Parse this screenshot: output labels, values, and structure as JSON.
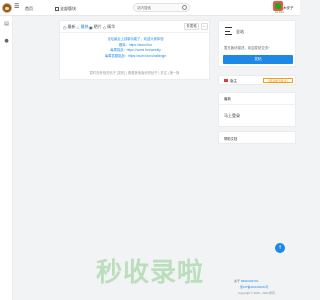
{
  "header": {
    "nav_home": "首页",
    "nav_all": "全部版块",
    "search_placeholder": "站内搜索",
    "user_name": "木安子",
    "user_level": "lv1 0/10"
  },
  "tabs": [
    {
      "label": "最新",
      "icon": "clock-icon"
    },
    {
      "label": "最热",
      "icon": "fire-icon"
    },
    {
      "label": "晒片",
      "icon": "image-icon"
    },
    {
      "label": "精华",
      "icon": "diamond-icon"
    }
  ],
  "toolbar": {
    "apply_label": "去发帖",
    "more_label": "⋯"
  },
  "announcement": {
    "lines": [
      "论坛最近上线新功能了，欢迎大家体验",
      "题库：https://xuexi.fun",
      "每周挑战：https://xuexi.fun/weekly",
      "每周答题挑战：https://xuexi.fun/challenge"
    ]
  },
  "empty_tip": "暂时没有相关帖子 [发布] | 看看其他版块的帖子 | 关注 | 换一换",
  "sidebar_right": {
    "card_title": "全站",
    "card_desc": "暂无版块描述，欢迎发帖交流~",
    "publish_label": "发帖",
    "flag_label": "版主",
    "flag_link": "（申请成为版主）",
    "login_section_title": "最新",
    "login_label": "马上登录",
    "docs_label": "帮助文档"
  },
  "footer": {
    "about_prefix": "关于",
    "about_link": "9999.099.5th",
    "icp": "浙ICP备2021000001号",
    "copyright": "Copyright © 2019 - 2023 所有"
  },
  "watermark": "秒收录啦",
  "colors": {
    "accent": "#1e88e5",
    "page_bg": "#f2f3f5",
    "flag": "#e53935",
    "warn": "#e08a00"
  }
}
